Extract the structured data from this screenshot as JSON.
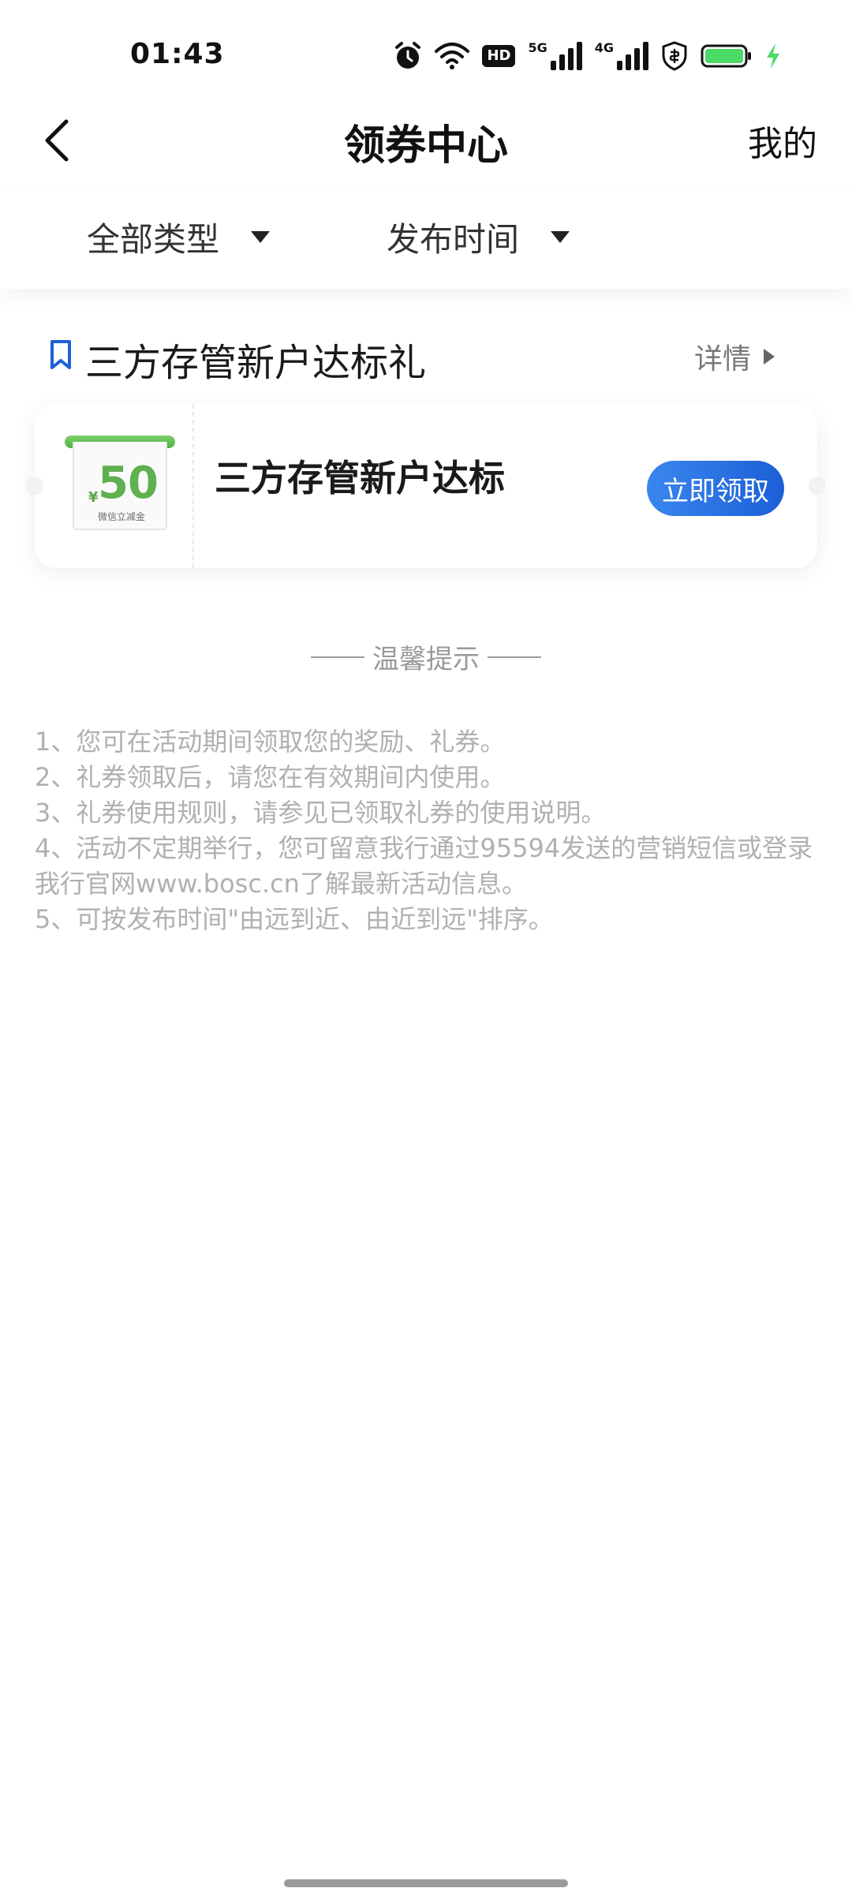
{
  "status_bar": {
    "time": "01:43",
    "icons": [
      "alarm-icon",
      "wifi-icon",
      "hd-icon",
      "signal-5g-icon",
      "signal-4g-icon",
      "shield-icon",
      "battery-icon",
      "charging-icon"
    ],
    "hd_label": "HD",
    "net1_label": "5G",
    "net2_label": "4G",
    "battery_color": "#4cd964"
  },
  "nav": {
    "title": "领券中心",
    "right_label": "我的"
  },
  "filters": {
    "type_label": "全部类型",
    "time_label": "发布时间"
  },
  "section": {
    "title": "三方存管新户达标礼",
    "detail_label": "详情",
    "accent_color": "#1a5fd6"
  },
  "coupon": {
    "currency": "¥",
    "amount": "50",
    "sub_label": "微信立减金",
    "name": "三方存管新户达标",
    "claim_label": "立即领取",
    "button_color": "#2a74e6",
    "coupon_color": "#5fb04f"
  },
  "tips": {
    "title": "温馨提示",
    "items": [
      "1、您可在活动期间领取您的奖励、礼券。",
      "2、礼券领取后，请您在有效期间内使用。",
      "3、礼券使用规则，请参见已领取礼券的使用说明。",
      "4、活动不定期举行，您可留意我行通过95594发送的营销短信或登录我行官网www.bosc.cn了解最新活动信息。",
      "5、可按发布时间\"由远到近、由近到远\"排序。"
    ]
  }
}
